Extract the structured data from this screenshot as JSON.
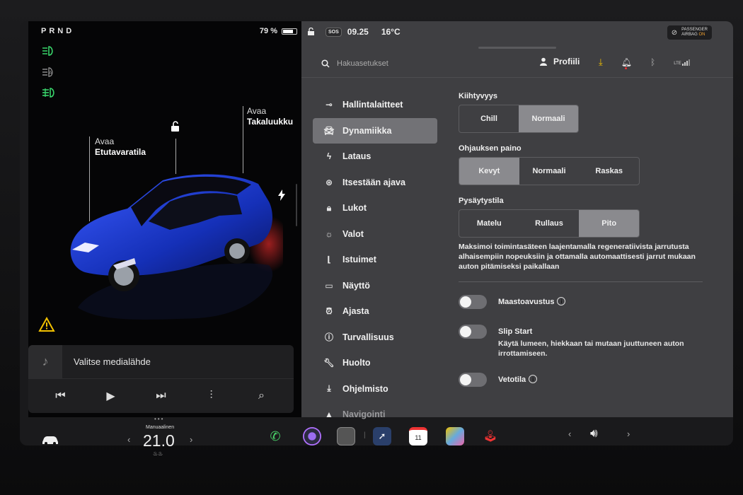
{
  "left": {
    "gear": "PRND",
    "battery_pct": "79 %",
    "battery_level": 0.79,
    "callout_front": {
      "line1": "Avaa",
      "line2": "Etutavaratila"
    },
    "callout_rear": {
      "line1": "Avaa",
      "line2": "Takaluukku"
    },
    "media_title": "Valitse medialähde"
  },
  "status": {
    "time": "09.25",
    "temp": "16°C",
    "sos": "SOS",
    "airbag_line1": "PASSENGER",
    "airbag_line2a": "AIRBAG",
    "airbag_line2b": "ON",
    "lte": "LTE"
  },
  "search": {
    "placeholder": "Hakuasetukset"
  },
  "profile": {
    "label": "Profiili"
  },
  "nav": [
    {
      "label": "Hallintalaitteet",
      "icon": "toggle-icon"
    },
    {
      "label": "Dynamiikka",
      "icon": "car-icon",
      "active": true
    },
    {
      "label": "Lataus",
      "icon": "lightning-icon"
    },
    {
      "label": "Itsestään ajava",
      "icon": "steering-wheel-icon"
    },
    {
      "label": "Lukot",
      "icon": "lock-icon"
    },
    {
      "label": "Valot",
      "icon": "sun-icon"
    },
    {
      "label": "Istuimet",
      "icon": "seat-icon"
    },
    {
      "label": "Näyttö",
      "icon": "display-icon"
    },
    {
      "label": "Ajasta",
      "icon": "alarm-icon"
    },
    {
      "label": "Turvallisuus",
      "icon": "info-icon"
    },
    {
      "label": "Huolto",
      "icon": "wrench-icon"
    },
    {
      "label": "Ohjelmisto",
      "icon": "download-icon"
    },
    {
      "label": "Navigointi",
      "icon": "navigation-icon"
    }
  ],
  "settings": {
    "acceleration": {
      "label": "Kiihtyvyys",
      "options": [
        "Chill",
        "Normaali"
      ],
      "selected": "Normaali"
    },
    "steering": {
      "label": "Ohjauksen paino",
      "options": [
        "Kevyt",
        "Normaali",
        "Raskas"
      ],
      "selected": "Kevyt"
    },
    "stopmode": {
      "label": "Pysäytystila",
      "options": [
        "Matelu",
        "Rullaus",
        "Pito"
      ],
      "selected": "Pito",
      "description": "Maksimoi toimintasäteen laajentamalla regeneratiivista jarrutusta alhaisempiin nopeuksiin ja ottamalla automaattisesti jarrut mukaan auton pitämiseksi paikallaan"
    },
    "offroad": {
      "label": "Maastoavustus"
    },
    "slipstart": {
      "label": "Slip Start",
      "description": "Käytä lumeen, hiekkaan tai mutaan juuttuneen auton irrottamiseen."
    },
    "towing": {
      "label": "Vetotila"
    }
  },
  "dock": {
    "temp_label": "Manuaalinen",
    "temp_value": "21.0",
    "calendar_day": "11"
  }
}
